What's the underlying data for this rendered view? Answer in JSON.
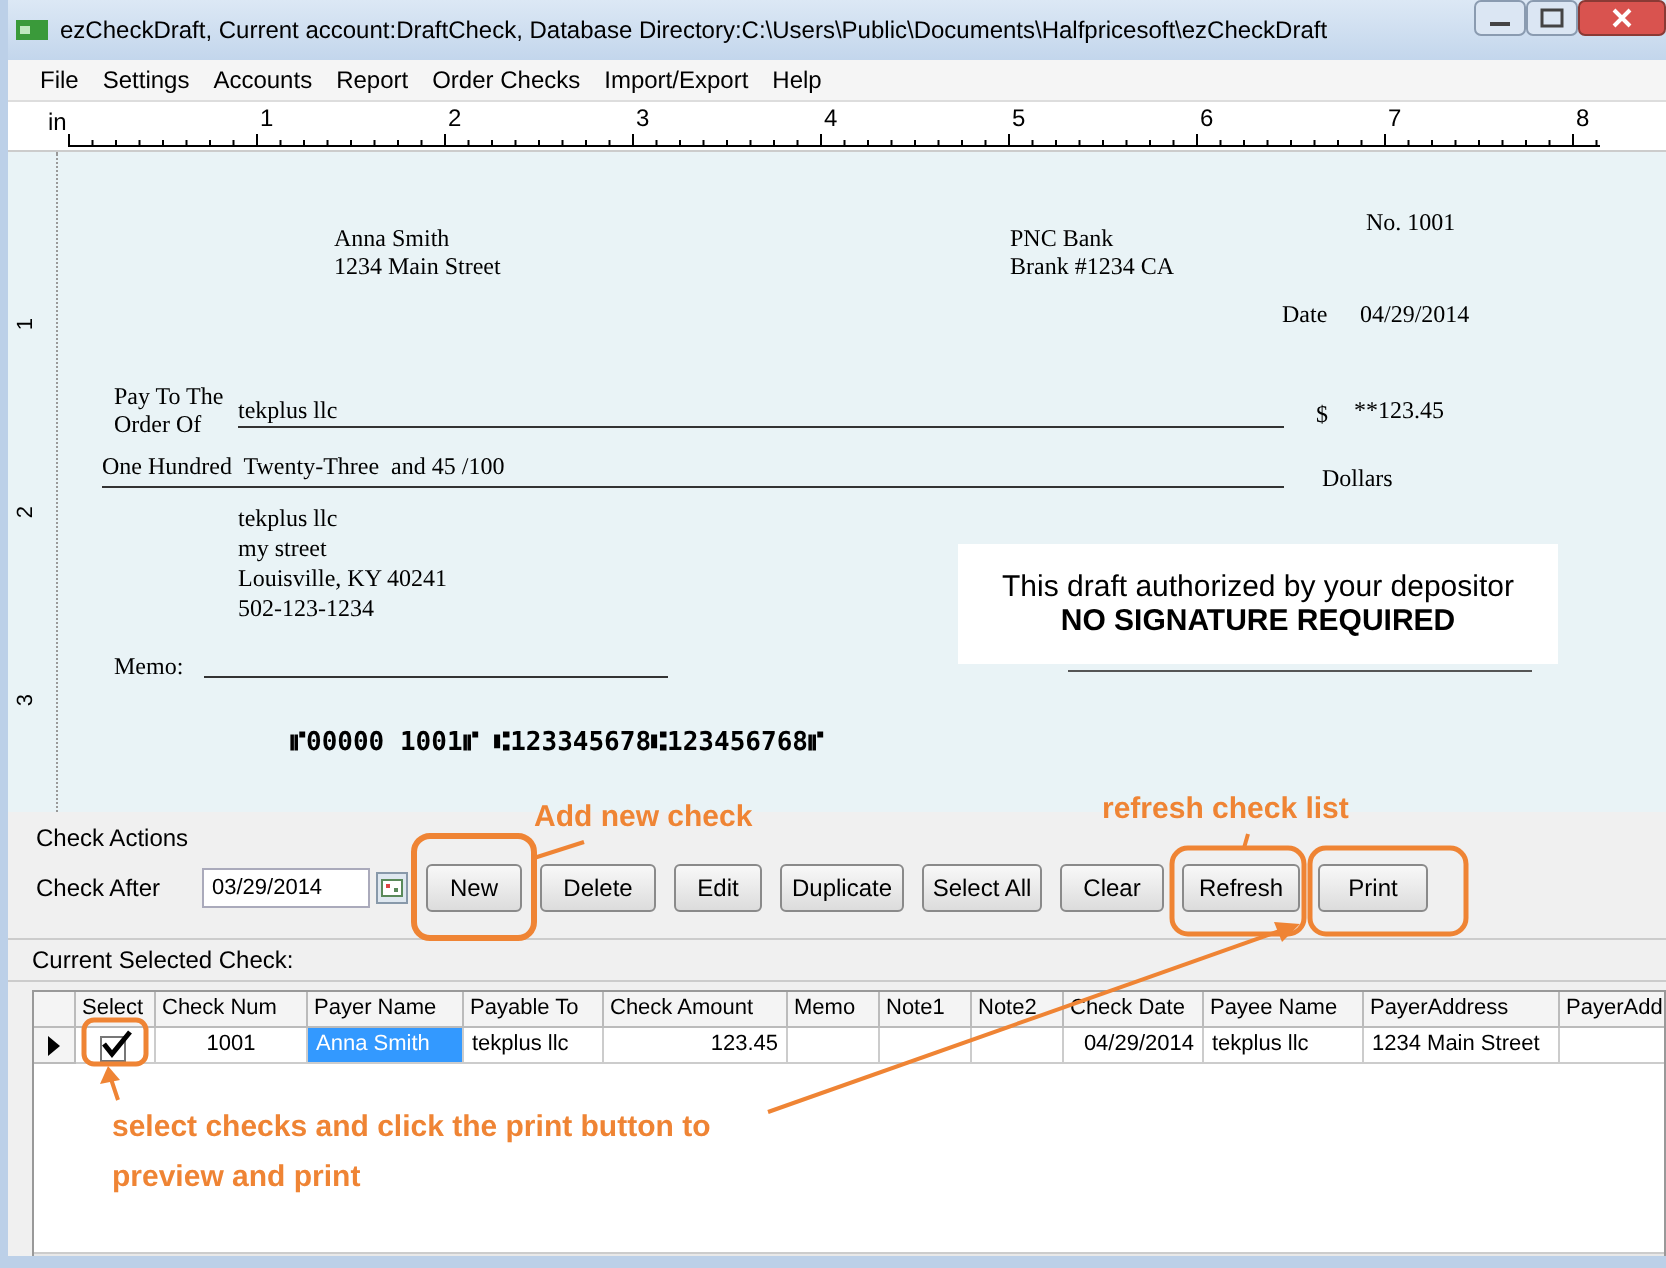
{
  "window": {
    "title": "ezCheckDraft, Current account:DraftCheck, Database Directory:C:\\Users\\Public\\Documents\\Halfpricesoft\\ezCheckDraft"
  },
  "menu": [
    "File",
    "Settings",
    "Accounts",
    "Report",
    "Order Checks",
    "Import/Export",
    "Help"
  ],
  "ruler": {
    "unit": "in",
    "labels": [
      "1",
      "2",
      "3",
      "4",
      "5",
      "6",
      "7",
      "8"
    ],
    "vertical_labels": [
      "1",
      "2",
      "3"
    ]
  },
  "check": {
    "payer_name": "Anna Smith",
    "payer_address": "1234 Main Street",
    "bank_name": "PNC Bank",
    "bank_branch": "Brank #1234 CA",
    "number": "No. 1001",
    "date_label": "Date",
    "date": "04/29/2014",
    "pay_to_label": "Pay To The",
    "order_of_label": "Order Of",
    "payee": "tekplus llc",
    "currency": "$",
    "amount": "**123.45",
    "amount_words": "One Hundred  Twenty-Three  and 45 /100",
    "dollars_label": "Dollars",
    "payee_address": [
      "tekplus llc",
      "my street",
      "Louisville, KY 40241",
      "502-123-1234"
    ],
    "memo_label": "Memo:",
    "authorization": "This draft authorized by your depositor",
    "signature_note": "NO SIGNATURE REQUIRED",
    "micr": "⑈00000 1001⑈ ⑆123345678⑆123456768⑈"
  },
  "actions": {
    "title": "Check Actions",
    "check_after_label": "Check After",
    "check_after": "03/29/2014",
    "buttons": [
      "New",
      "Delete",
      "Edit",
      "Duplicate",
      "Select All",
      "Clear",
      "Refresh",
      "Print"
    ]
  },
  "grid": {
    "title": "Current Selected Check:",
    "columns": [
      "Select",
      "Check Num",
      "Payer Name",
      "Payable To",
      "Check Amount",
      "Memo",
      "Note1",
      "Note2",
      "Check Date",
      "Payee Name",
      "PayerAddress",
      "PayerAdd"
    ],
    "rows": [
      {
        "selected": true,
        "checked": true,
        "cells": [
          "",
          "1001",
          "Anna Smith",
          "tekplus llc",
          "123.45",
          "",
          "",
          "",
          "04/29/2014",
          "tekplus llc",
          "1234 Main Street",
          ""
        ]
      }
    ]
  },
  "annotations": [
    "Add new check",
    "refresh check list",
    "select checks and click the print button to\npreview and print"
  ]
}
